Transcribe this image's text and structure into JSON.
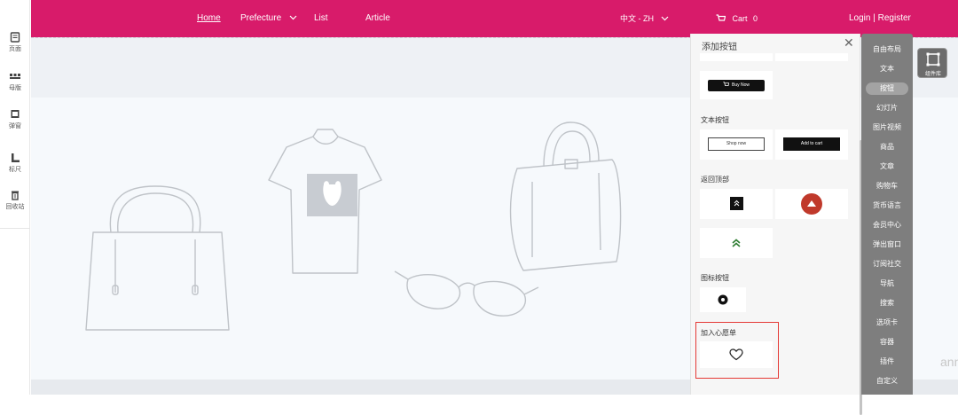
{
  "rail": {
    "items": [
      {
        "label": "页面",
        "icon": "page-icon"
      },
      {
        "label": "母版",
        "icon": "master-icon"
      },
      {
        "label": "弹窗",
        "icon": "popup-icon"
      },
      {
        "label": "标尺",
        "icon": "ruler-icon"
      },
      {
        "label": "回收站",
        "icon": "trash-icon"
      }
    ]
  },
  "topnav": {
    "home": "Home",
    "prefecture": "Prefecture",
    "list": "List",
    "article": "Article",
    "language": "中文 - ZH",
    "cart": "Cart",
    "cart_count": "0",
    "login": "Login | Register"
  },
  "canvas": {
    "watermark": "anner"
  },
  "panel": {
    "title": "添加按钮",
    "buy_now": "Buy Now",
    "text_button_section": "文本按钮",
    "shop_now": "Shop now",
    "add_to_cart": "Add to cart",
    "back_to_top_section": "返回顶部",
    "icon_button_section": "图标按钮",
    "wishlist_section": "加入心愿单"
  },
  "catmenu": {
    "items": [
      "自由布局",
      "文本",
      "按钮",
      "幻灯片",
      "图片视频",
      "商品",
      "文章",
      "购物车",
      "货币语言",
      "会员中心",
      "弹出窗口",
      "订阅社交",
      "导航",
      "搜索",
      "选项卡",
      "容器",
      "插件",
      "自定义"
    ],
    "active_index": 2
  },
  "library": {
    "label": "组件库"
  },
  "colors": {
    "brand": "#d81b6a",
    "menu_grey": "#7e7e7e",
    "highlight_red": "#e53935",
    "back_top_red": "#c0392b"
  }
}
